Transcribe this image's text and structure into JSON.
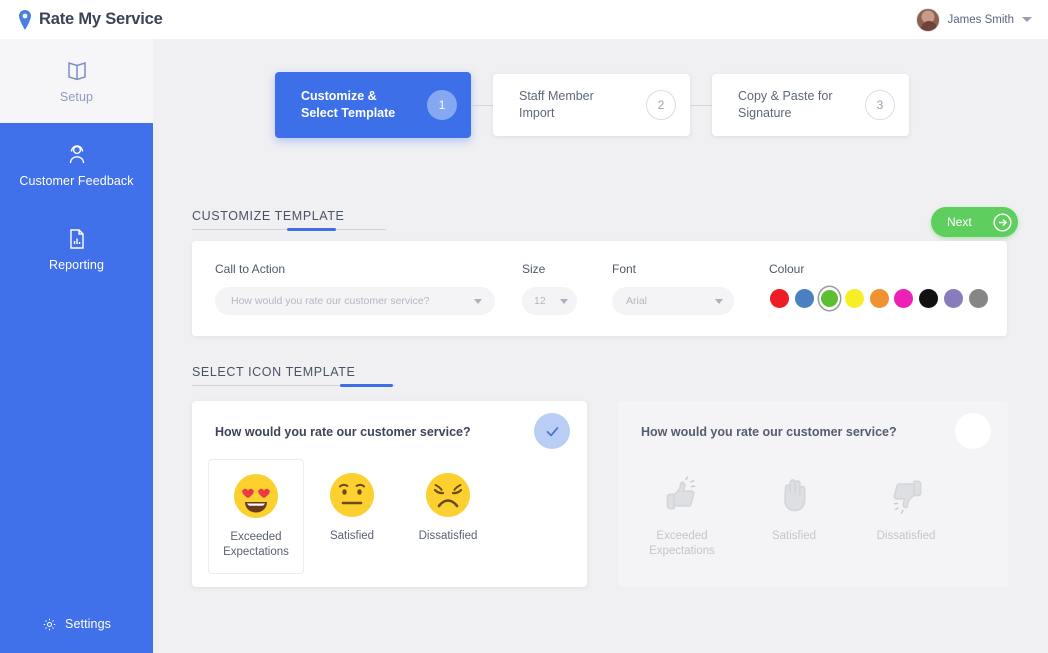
{
  "app": {
    "brand": "Rate My Service",
    "brand_logo_icon": "location-pin-icon",
    "bg_color": "#f0f0f2",
    "accent_blue": "#3d6fe8",
    "accent_green": "#5ecf5e"
  },
  "topbar": {
    "user_name": "James Smith",
    "avatar_icon": "avatar",
    "caret_icon": "chevron-down-icon"
  },
  "sidebar": {
    "items": [
      {
        "label": "Setup",
        "icon": "open-book-icon",
        "active": false
      },
      {
        "label": "Customer Feedback",
        "icon": "user-headset-icon",
        "active": true
      },
      {
        "label": "Reporting",
        "icon": "document-chart-icon",
        "active": false
      }
    ],
    "settings": {
      "label": "Settings",
      "icon": "gear-icon"
    }
  },
  "steps": [
    {
      "line1": "Customize &",
      "line2": "Select Template",
      "number": "1",
      "active": true
    },
    {
      "line1": "Staff Member",
      "line2": "Import",
      "number": "2",
      "active": false
    },
    {
      "line1": "Copy & Paste for",
      "line2": "Signature",
      "number": "3",
      "active": false
    }
  ],
  "sections": {
    "customize_template": "CUSTOMIZE TEMPLATE",
    "select_icon_template": "SELECT ICON TEMPLATE"
  },
  "next_button": {
    "label": "Next",
    "icon": "arrow-right-circle-icon"
  },
  "customize": {
    "call_to_action": {
      "label": "Call to Action",
      "value": "How would you rate our customer service?",
      "caret_icon": "chevron-down-icon"
    },
    "size": {
      "label": "Size",
      "value": "12",
      "caret_icon": "chevron-down-icon"
    },
    "font": {
      "label": "Font",
      "value": "Arial",
      "caret_icon": "chevron-down-icon"
    },
    "colour": {
      "label": "Colour",
      "selected_index": 2,
      "swatches": [
        {
          "name": "red",
          "hex": "#ee1c24"
        },
        {
          "name": "blue",
          "hex": "#4a7fc1"
        },
        {
          "name": "green",
          "hex": "#5cbf32"
        },
        {
          "name": "yellow",
          "hex": "#f6ef28"
        },
        {
          "name": "orange",
          "hex": "#f0922f"
        },
        {
          "name": "magenta",
          "hex": "#ee21b6"
        },
        {
          "name": "black",
          "hex": "#111111"
        },
        {
          "name": "purple",
          "hex": "#8a7bbd"
        },
        {
          "name": "grey",
          "hex": "#868686"
        }
      ]
    }
  },
  "templates": [
    {
      "question": "How would you rate our customer service?",
      "selected": true,
      "badge_icon": "check-icon",
      "options": [
        {
          "label": "Exceeded Expectations",
          "icon": "heart-eyes-emoji-icon",
          "selected": true
        },
        {
          "label": "Satisfied",
          "icon": "neutral-face-emoji-icon",
          "selected": false
        },
        {
          "label": "Dissatisfied",
          "icon": "sad-face-emoji-icon",
          "selected": false
        }
      ]
    },
    {
      "question": "How would you rate our customer service?",
      "selected": false,
      "badge_icon": "empty-circle-icon",
      "options": [
        {
          "label": "Exceeded Expectations",
          "icon": "thumbs-up-icon",
          "selected": false
        },
        {
          "label": "Satisfied",
          "icon": "open-hand-icon",
          "selected": false
        },
        {
          "label": "Dissatisfied",
          "icon": "thumbs-down-icon",
          "selected": false
        }
      ]
    }
  ]
}
